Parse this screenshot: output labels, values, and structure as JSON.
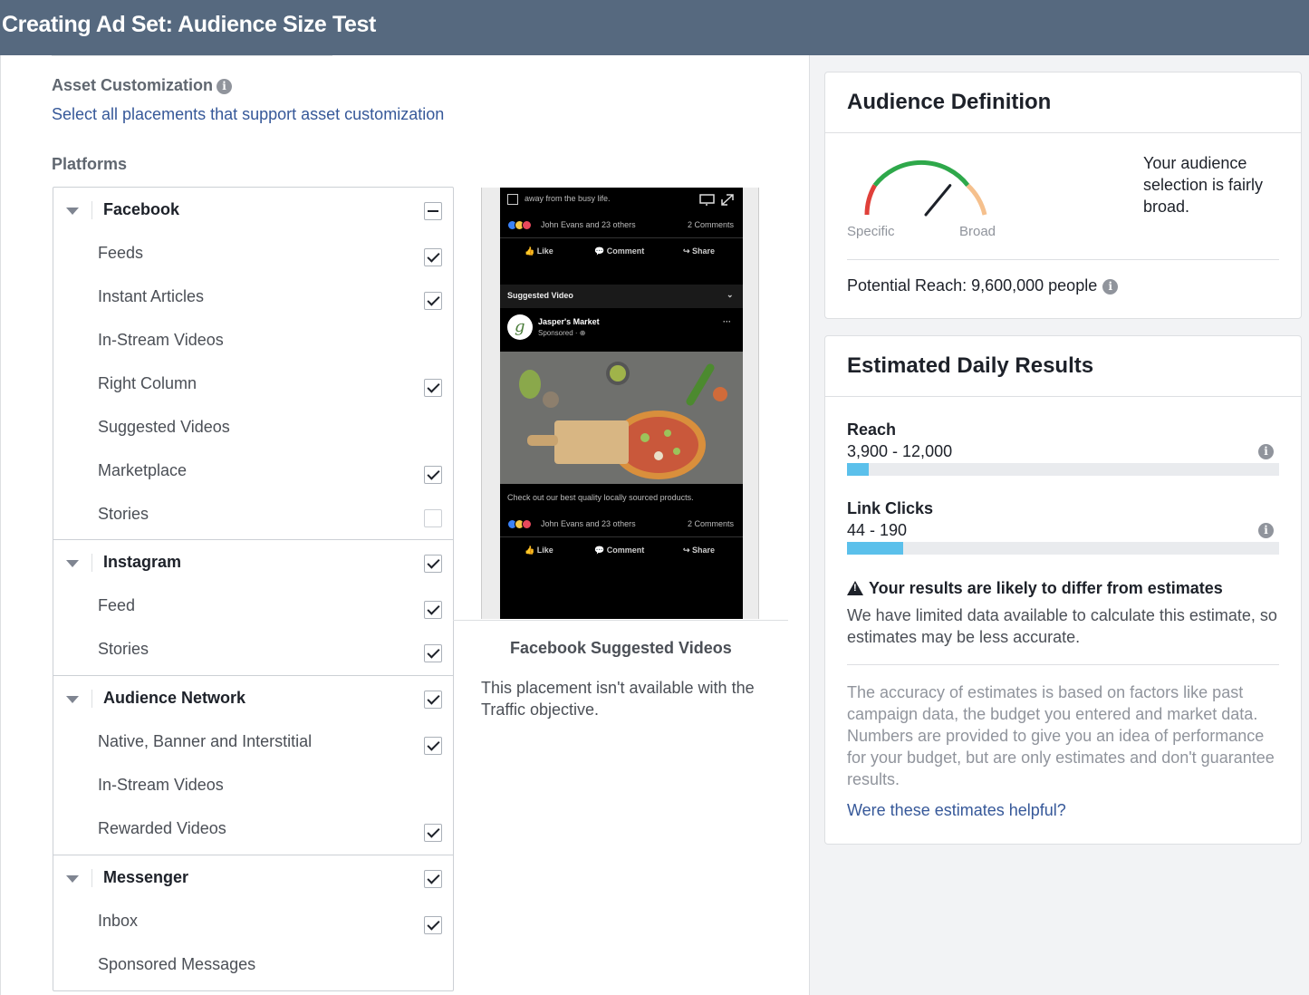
{
  "window": {
    "title": "Creating Ad Set: Audience Size Test"
  },
  "asset_customization": {
    "title": "Asset Customization",
    "link": "Select all placements that support asset customization"
  },
  "platforms": {
    "title": "Platforms",
    "groups": [
      {
        "name": "Facebook",
        "state": "partial",
        "items": [
          {
            "label": "Feeds",
            "checked": true
          },
          {
            "label": "Instant Articles",
            "checked": true
          },
          {
            "label": "In-Stream Videos",
            "checked": null
          },
          {
            "label": "Right Column",
            "checked": true
          },
          {
            "label": "Suggested Videos",
            "checked": null
          },
          {
            "label": "Marketplace",
            "checked": true
          },
          {
            "label": "Stories",
            "checked": false
          }
        ]
      },
      {
        "name": "Instagram",
        "state": "checked",
        "items": [
          {
            "label": "Feed",
            "checked": true
          },
          {
            "label": "Stories",
            "checked": true
          }
        ]
      },
      {
        "name": "Audience Network",
        "state": "checked",
        "items": [
          {
            "label": "Native, Banner and Interstitial",
            "checked": true
          },
          {
            "label": "In-Stream Videos",
            "checked": null
          },
          {
            "label": "Rewarded Videos",
            "checked": true
          }
        ]
      },
      {
        "name": "Messenger",
        "state": "checked",
        "items": [
          {
            "label": "Inbox",
            "checked": true
          },
          {
            "label": "Sponsored Messages",
            "checked": null
          }
        ]
      }
    ]
  },
  "preview": {
    "top_caption": "away from the busy life.",
    "reactions_text": "John Evans and 23 others",
    "comments_count": "2 Comments",
    "like_label": "Like",
    "comment_label": "Comment",
    "share_label": "Share",
    "section_label": "Suggested Video",
    "page_name": "Jasper's Market",
    "sponsored_label": "Sponsored · ⊕",
    "post_text": "Check out our best quality locally sourced products.",
    "placement_title": "Facebook Suggested Videos",
    "placement_note": "This placement isn't available with the Traffic objective."
  },
  "audience_definition": {
    "title": "Audience Definition",
    "gauge_left_label": "Specific",
    "gauge_right_label": "Broad",
    "gauge_level": 0.72,
    "summary": "Your audience selection is fairly broad.",
    "potential_reach": "Potential Reach: 9,600,000 people"
  },
  "estimated_daily_results": {
    "title": "Estimated Daily Results",
    "metrics": [
      {
        "name": "Reach",
        "value": "3,900 - 12,000",
        "fill_fraction": 0.05
      },
      {
        "name": "Link Clicks",
        "value": "44 - 190",
        "fill_fraction": 0.13
      }
    ],
    "warning_title": "Your results are likely to differ from estimates",
    "warning_text": "We have limited data available to calculate this estimate, so estimates may be less accurate.",
    "accuracy_text": "The accuracy of estimates is based on factors like past campaign data, the budget you entered and market data. Numbers are provided to give you an idea of performance for your budget, but are only estimates and don't guarantee results.",
    "helpful_link": "Were these estimates helpful?"
  },
  "colors": {
    "titlebar": "#56697f",
    "link": "#365899",
    "progress_fill": "#5bc0eb",
    "gauge_red": "#e0403a",
    "gauge_green": "#2ea84a",
    "gauge_orange": "#f5c08d"
  }
}
